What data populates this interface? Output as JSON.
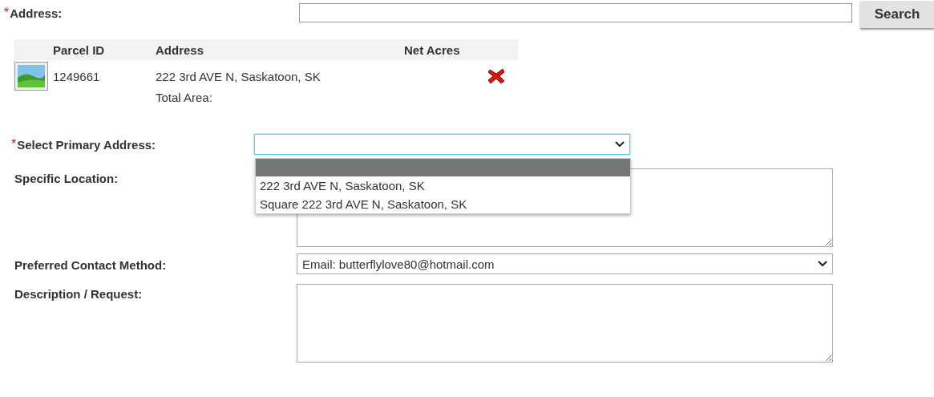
{
  "address": {
    "required_mark": "*",
    "label": "Address:",
    "search_button": "Search"
  },
  "parcels": {
    "columns": [
      "Parcel ID",
      "Address",
      "Net Acres"
    ],
    "rows": [
      {
        "parcel_id": "1249661",
        "address": "222 3rd AVE N, Saskatoon, SK"
      }
    ],
    "total_label": "Total Area:"
  },
  "primary_address": {
    "required_mark": "*",
    "label": "Select Primary Address:",
    "focused": true,
    "expanded": true,
    "blank_option": {
      "highlighted": true
    },
    "options": [
      {
        "label": "222 3rd AVE N, Saskatoon, SK",
        "highlighted": false
      },
      {
        "label": "Square 222 3rd AVE N, Saskatoon, SK",
        "highlighted": false
      }
    ]
  },
  "specific_location": {
    "label": "Specific Location:"
  },
  "contact_method": {
    "label": "Preferred Contact Method:",
    "value": "Email: butterflylove80@hotmail.com"
  },
  "description": {
    "label": "Description / Request:"
  }
}
